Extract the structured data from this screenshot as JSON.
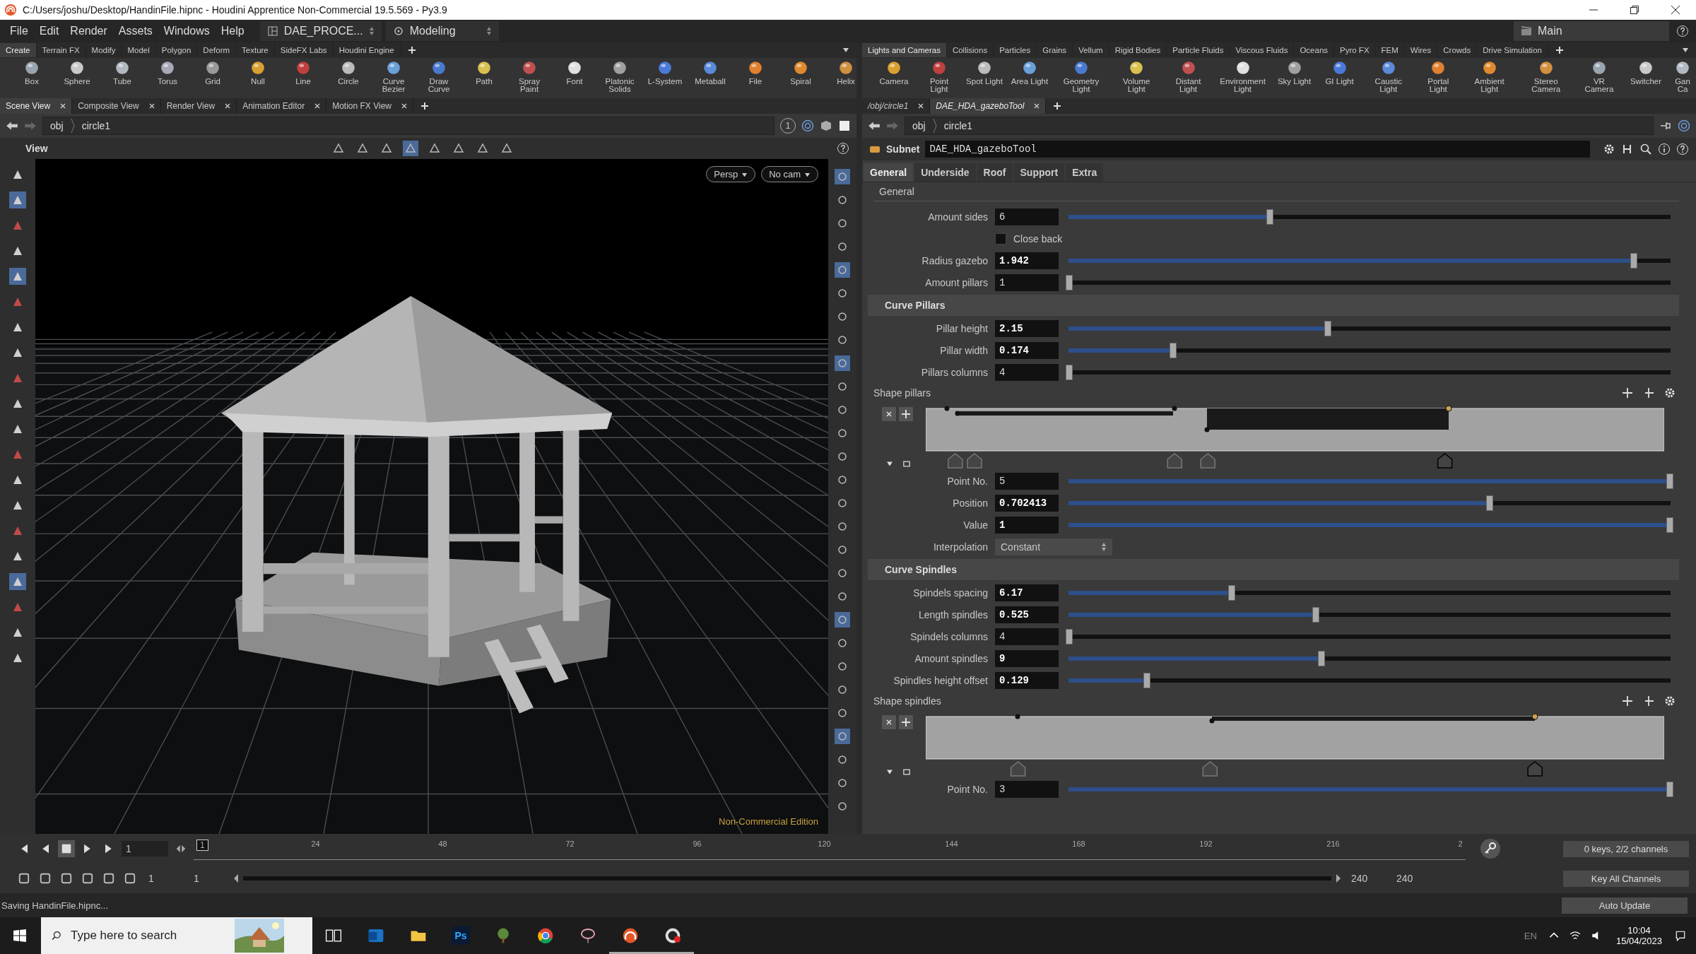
{
  "title_bar": {
    "title": "C:/Users/joshu/Desktop/HandinFile.hipnc - Houdini Apprentice Non-Commercial 19.5.569 - Py3.9"
  },
  "menu_bar": {
    "items": [
      "File",
      "Edit",
      "Render",
      "Assets",
      "Windows",
      "Help"
    ],
    "desktop": "DAE_PROCE...",
    "context": "Modeling",
    "layout": "Main"
  },
  "shelf_left": {
    "tabs": [
      {
        "label": "Create",
        "selected": true
      },
      {
        "label": "Terrain FX",
        "selected": false
      },
      {
        "label": "Modify",
        "selected": false
      },
      {
        "label": "Model",
        "selected": false
      },
      {
        "label": "Polygon",
        "selected": false
      },
      {
        "label": "Deform",
        "selected": false
      },
      {
        "label": "Texture",
        "selected": false
      },
      {
        "label": "SideFX Labs",
        "selected": false
      },
      {
        "label": "Houdini Engine",
        "selected": false
      }
    ],
    "tools": [
      "Box",
      "Sphere",
      "Tube",
      "Torus",
      "Grid",
      "Null",
      "Line",
      "Circle",
      "Curve Bezier",
      "Draw Curve",
      "Path",
      "Spray Paint",
      "Font",
      "Platonic Solids",
      "L-System",
      "Metaball",
      "File",
      "Spiral",
      "Helix"
    ]
  },
  "shelf_right": {
    "tabs": [
      {
        "label": "Lights and Cameras",
        "selected": true
      },
      {
        "label": "Collisions",
        "selected": false
      },
      {
        "label": "Particles",
        "selected": false
      },
      {
        "label": "Grains",
        "selected": false
      },
      {
        "label": "Vellum",
        "selected": false
      },
      {
        "label": "Rigid Bodies",
        "selected": false
      },
      {
        "label": "Particle Fluids",
        "selected": false
      },
      {
        "label": "Viscous Fluids",
        "selected": false
      },
      {
        "label": "Oceans",
        "selected": false
      },
      {
        "label": "Pyro FX",
        "selected": false
      },
      {
        "label": "FEM",
        "selected": false
      },
      {
        "label": "Wires",
        "selected": false
      },
      {
        "label": "Crowds",
        "selected": false
      },
      {
        "label": "Drive Simulation",
        "selected": false
      }
    ],
    "tools": [
      "Camera",
      "Point Light",
      "Spot Light",
      "Area Light",
      "Geometry Light",
      "Volume Light",
      "Distant Light",
      "Environment Light",
      "Sky Light",
      "GI Light",
      "Caustic Light",
      "Portal Light",
      "Ambient Light",
      "Stereo Camera",
      "VR Camera",
      "Switcher",
      "Gan Ca"
    ]
  },
  "left_pane": {
    "tabs": [
      {
        "label": "Scene View",
        "selected": true
      },
      {
        "label": "Composite View",
        "selected": false
      },
      {
        "label": "Render View",
        "selected": false
      },
      {
        "label": "Animation Editor",
        "selected": false
      },
      {
        "label": "Motion FX View",
        "selected": false
      }
    ],
    "path": [
      "obj",
      "circle1"
    ],
    "path_badge": "1",
    "viewport": {
      "title": "View",
      "camera_buttons": [
        "Persp",
        "No cam"
      ],
      "edition_text": "Non-Commercial Edition"
    }
  },
  "right_pane": {
    "tabs": [
      {
        "label": "/obj/circle1",
        "selected": false
      },
      {
        "label": "DAE_HDA_gazeboTool",
        "selected": true
      }
    ],
    "path": [
      "obj",
      "circle1"
    ],
    "node_type": "Subnet",
    "node_name": "DAE_HDA_gazeboTool",
    "param_tabs": [
      {
        "label": "General",
        "selected": true
      },
      {
        "label": "Underside",
        "selected": false
      },
      {
        "label": "Roof",
        "selected": false
      },
      {
        "label": "Support",
        "selected": false
      },
      {
        "label": "Extra",
        "selected": false
      }
    ],
    "params": [
      {
        "kind": "heading",
        "label": "General"
      },
      {
        "kind": "slider",
        "label": "Amount sides",
        "value": "6",
        "modified": false,
        "level": 0.334
      },
      {
        "kind": "checkbox",
        "label": "Close back",
        "checked": false
      },
      {
        "kind": "slider",
        "label": "Radius gazebo",
        "value": "1.942",
        "modified": true,
        "level": 0.94
      },
      {
        "kind": "slider",
        "label": "Amount pillars",
        "value": "1",
        "modified": false,
        "level": 0
      },
      {
        "kind": "folder",
        "label": "Curve Pillars"
      },
      {
        "kind": "slider",
        "label": "Pillar height",
        "value": "2.15",
        "modified": true,
        "level": 0.43
      },
      {
        "kind": "slider",
        "label": "Pillar width",
        "value": "0.174",
        "modified": true,
        "level": 0.173
      },
      {
        "kind": "slider",
        "label": "Pillars columns",
        "value": "4",
        "modified": false,
        "level": 0
      },
      {
        "kind": "ramp",
        "label": "Shape pillars"
      },
      {
        "kind": "slider",
        "label": "Point No.",
        "value": "5",
        "modified": false,
        "level": 1
      },
      {
        "kind": "slider",
        "label": "Position",
        "value": "0.702413",
        "modified": true,
        "level": 0.7
      },
      {
        "kind": "slider",
        "label": "Value",
        "value": "1",
        "modified": true,
        "level": 1
      },
      {
        "kind": "dropdown",
        "label": "Interpolation",
        "value": "Constant"
      },
      {
        "kind": "folder",
        "label": "Curve Spindles"
      },
      {
        "kind": "slider",
        "label": "Spindels spacing",
        "value": "6.17",
        "modified": true,
        "level": 0.27
      },
      {
        "kind": "slider",
        "label": "Length spindles",
        "value": "0.525",
        "modified": true,
        "level": 0.41
      },
      {
        "kind": "slider",
        "label": "Spindels columns",
        "value": "4",
        "modified": false,
        "level": 0
      },
      {
        "kind": "slider",
        "label": "Amount spindles",
        "value": "9",
        "modified": true,
        "level": 0.42
      },
      {
        "kind": "slider",
        "label": "Spindles height offset",
        "value": "0.129",
        "modified": true,
        "level": 0.13
      },
      {
        "kind": "ramp",
        "label": "Shape spindles"
      },
      {
        "kind": "slider",
        "label": "Point No.",
        "value": "3",
        "modified": false,
        "level": 1
      }
    ]
  },
  "timeline": {
    "current_frame": "1",
    "marker": "1",
    "ticks": [
      "24",
      "48",
      "72",
      "96",
      "120",
      "144",
      "168",
      "192",
      "216",
      "2"
    ],
    "start": "1",
    "range_start": "1",
    "range_end": "240",
    "end": "240",
    "keys_info": "0 keys, 2/2 channels",
    "key_button": "Key All Channels"
  },
  "status_bar": {
    "message": "Saving HandinFile.hipnc...",
    "update_mode": "Auto Update"
  },
  "taskbar": {
    "search_placeholder": "Type here to search",
    "photoshop_label": "Ps",
    "language": "EN",
    "time": "10:04",
    "date": "15/04/2023"
  }
}
